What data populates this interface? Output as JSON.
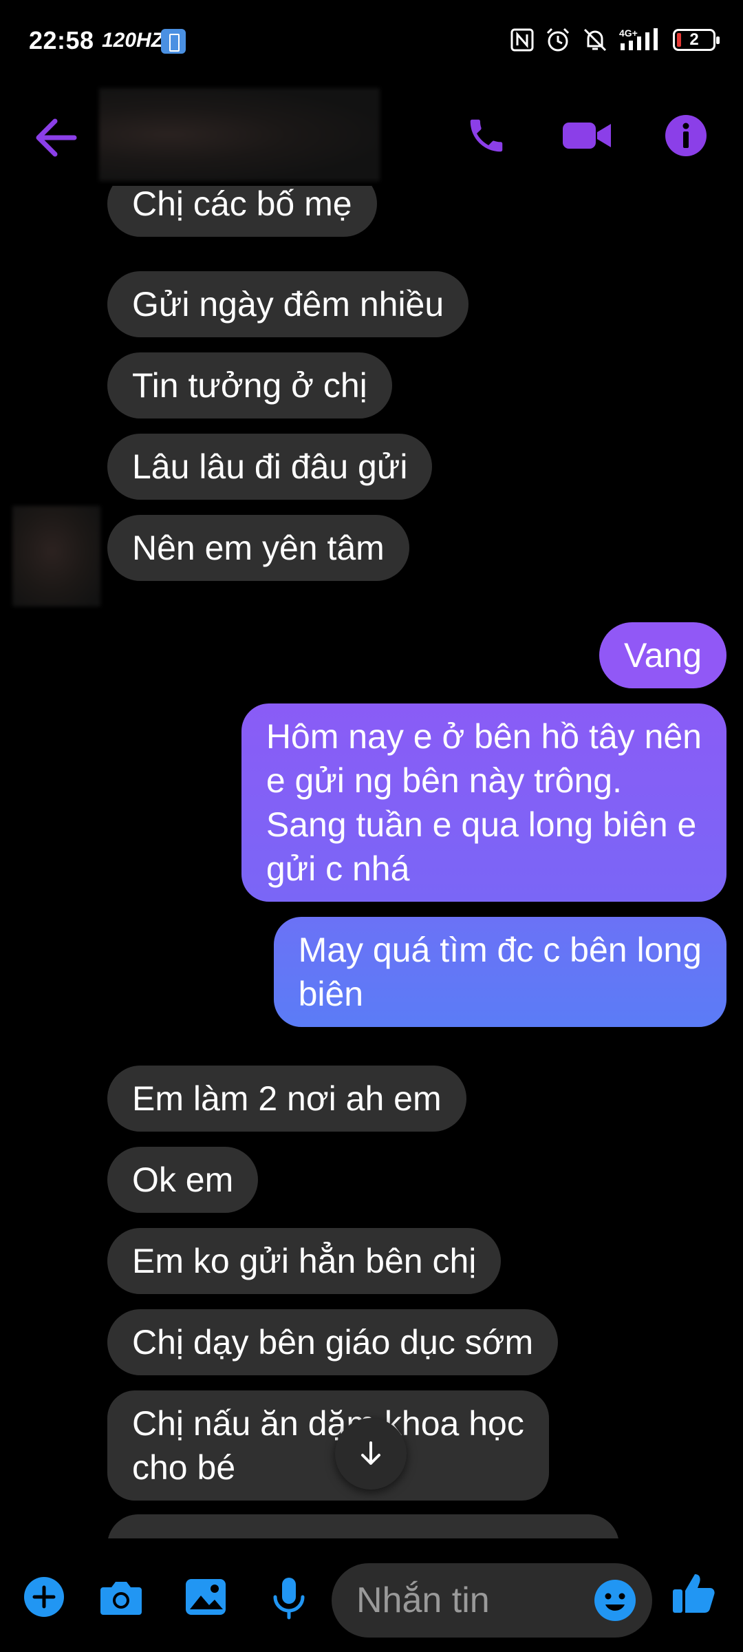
{
  "status_bar": {
    "time": "22:58",
    "refresh_rate": "120HZ",
    "battery_level": "2",
    "icons": [
      "nfc-icon",
      "alarm-icon",
      "mute-icon",
      "4g-signal-icon",
      "battery-icon"
    ]
  },
  "header": {
    "contact_name": "",
    "icons": [
      "back-arrow-icon",
      "phone-icon",
      "video-camera-icon",
      "info-icon"
    ]
  },
  "messages": [
    {
      "direction": "incoming",
      "text": "Chị các bố mẹ"
    },
    {
      "direction": "incoming",
      "text": "Gửi ngày đêm nhiều"
    },
    {
      "direction": "incoming",
      "text": "Tin tưởng ở chị"
    },
    {
      "direction": "incoming",
      "text": "Lâu lâu đi đâu gửi"
    },
    {
      "direction": "incoming",
      "text": "Nên em yên tâm"
    },
    {
      "direction": "outgoing",
      "text": "Vang"
    },
    {
      "direction": "outgoing",
      "text": "Hôm nay e ở bên hồ tây nên\ne gửi ng bên này trông.\nSang tuần e qua long biên e\ngửi c nhá"
    },
    {
      "direction": "outgoing",
      "text": "May quá tìm đc c bên long\nbiên"
    },
    {
      "direction": "incoming",
      "text": "Em làm 2 nơi ah em"
    },
    {
      "direction": "incoming",
      "text": "Ok em"
    },
    {
      "direction": "incoming",
      "text": "Em ko gửi hẳn bên chị"
    },
    {
      "direction": "incoming",
      "text": "Chị dạy bên giáo dục sớm"
    },
    {
      "direction": "incoming",
      "text": "Chị nấu ăn dặm khoa học\ncho bé"
    }
  ],
  "composer": {
    "placeholder": "Nhắn tin",
    "icons": [
      "plus-icon",
      "camera-icon",
      "gallery-icon",
      "microphone-icon",
      "emoji-icon",
      "thumbs-up-icon"
    ]
  },
  "colors": {
    "accent": "#8B3FE8",
    "outgoing_gradient_top": "#9158F6",
    "outgoing_gradient_bottom": "#5B7CF6",
    "incoming_bubble": "#303030",
    "composer_icons": "#2196F3"
  }
}
